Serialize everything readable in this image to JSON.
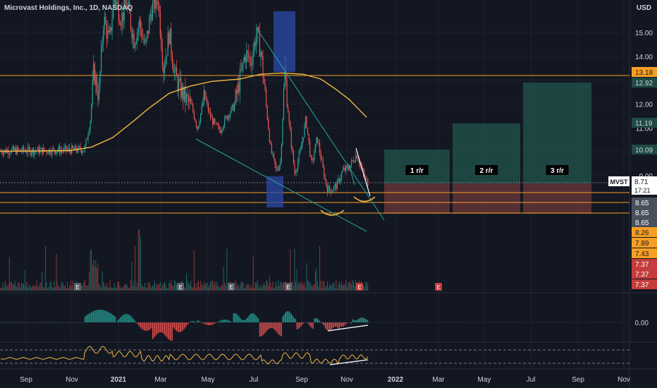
{
  "header": {
    "title": "Microvast Holdings, Inc., 1D, NASDAQ",
    "currency": "USD"
  },
  "colors": {
    "background": "#131722",
    "grid": "#1e2230",
    "axis_text": "#d1d4dc",
    "candle_up": "#26a69a",
    "candle_down": "#ef5350",
    "moving_average": "#f0b63f",
    "level_lines": "#f79f24",
    "trendline": "#26a69a",
    "highlight_box": "#2c49a8",
    "reward_zone": "#1f4a45",
    "risk_zone": "#5e3236",
    "price_tag": "#ffffff",
    "macd_up": "#26a69a",
    "macd_down": "#ef5350",
    "rsi_line": "#f0b63f",
    "divergence_line": "#ffffff"
  },
  "chart_data": [
    {
      "type": "candlestick",
      "panel": "price",
      "y_axis": {
        "unit": "USD",
        "ylim": [
          7.0,
          16.0
        ],
        "ticks": [
          9.0,
          10.0,
          11.0,
          12.0,
          13.0,
          14.0,
          15.0
        ],
        "tick_labels": [
          "9.00",
          "10.00",
          "11.00",
          "12.00",
          "13.00",
          "14.00",
          "15.00"
        ]
      },
      "x_axis": {
        "tick_labels": [
          "Sep",
          "Nov",
          "2021",
          "Mar",
          "May",
          "Jul",
          "Sep",
          "Nov",
          "2022",
          "Mar",
          "May",
          "Jul",
          "Sep",
          "Nov"
        ]
      },
      "price_series_summary": [
        {
          "period": "Sep 2020",
          "close": 10.05
        },
        {
          "period": "Oct 2020",
          "close": 10.1
        },
        {
          "period": "Nov 2020",
          "close": 10.2
        },
        {
          "period": "Dec 2020",
          "close": 13.5
        },
        {
          "period": "Jan 2021",
          "close": 15.8
        },
        {
          "period": "Feb 2021",
          "close": 15.2
        },
        {
          "period": "Mar 2021",
          "close": 12.6
        },
        {
          "period": "Apr 2021",
          "close": 11.8
        },
        {
          "period": "May 2021",
          "close": 10.9
        },
        {
          "period": "Jun 2021",
          "close": 12.9
        },
        {
          "period": "Jul 2021",
          "close": 14.3
        },
        {
          "period": "Aug 2021",
          "close": 9.0
        },
        {
          "period": "Sep 2021",
          "close": 11.5
        },
        {
          "period": "Oct 2021",
          "close": 8.35
        },
        {
          "period": "Nov 2021",
          "close": 9.9
        },
        {
          "period": "Dec 2021",
          "close": 8.71
        }
      ],
      "horizontal_levels": [
        13.18,
        8.71,
        8.65,
        8.26,
        8.55
      ],
      "moving_average_label": "",
      "annotations": [
        {
          "text": "1 r/r"
        },
        {
          "text": "2 r/r"
        },
        {
          "text": "3 r/r"
        }
      ],
      "price_labels": [
        {
          "value": "13.18",
          "color": "#f79f24",
          "text_color": "#131722"
        },
        {
          "value": "12.92",
          "color": "#1f4a45",
          "text_color": "#d1d4dc"
        },
        {
          "value": "11.19",
          "color": "#1f4a45",
          "text_color": "#d1d4dc"
        },
        {
          "value": "10.09",
          "color": "#1f4a45",
          "text_color": "#d1d4dc"
        },
        {
          "value": "8.71",
          "color": "#ffffff",
          "text_color": "#131722",
          "symbol": "MVST",
          "countdown": "17:21"
        },
        {
          "value": "8.65",
          "color": "#4a4f5c",
          "text_color": "#ffffff"
        },
        {
          "value": "8.65",
          "color": "#4a4f5c",
          "text_color": "#ffffff"
        },
        {
          "value": "8.65",
          "color": "#4a4f5c",
          "text_color": "#ffffff"
        },
        {
          "value": "8.26",
          "color": "#f79f24",
          "text_color": "#131722"
        },
        {
          "value": "7.89",
          "color": "#f79f24",
          "text_color": "#131722"
        },
        {
          "value": "7.43",
          "color": "#f79f24",
          "text_color": "#131722"
        },
        {
          "value": "7.37",
          "color": "#c43c3c",
          "text_color": "#ffffff"
        },
        {
          "value": "7.37",
          "color": "#c43c3c",
          "text_color": "#ffffff"
        },
        {
          "value": "7.37",
          "color": "#c43c3c",
          "text_color": "#ffffff"
        }
      ],
      "earnings_markers": [
        "E",
        "E",
        "E",
        "E",
        "E",
        "E"
      ]
    },
    {
      "type": "bar",
      "panel": "macd_histogram",
      "y_axis": {
        "ticks": [
          0.0
        ],
        "tick_labels": [
          "0.00"
        ]
      }
    },
    {
      "type": "line",
      "panel": "rsi",
      "y_axis": {
        "ticks": [],
        "tick_labels": []
      }
    }
  ]
}
